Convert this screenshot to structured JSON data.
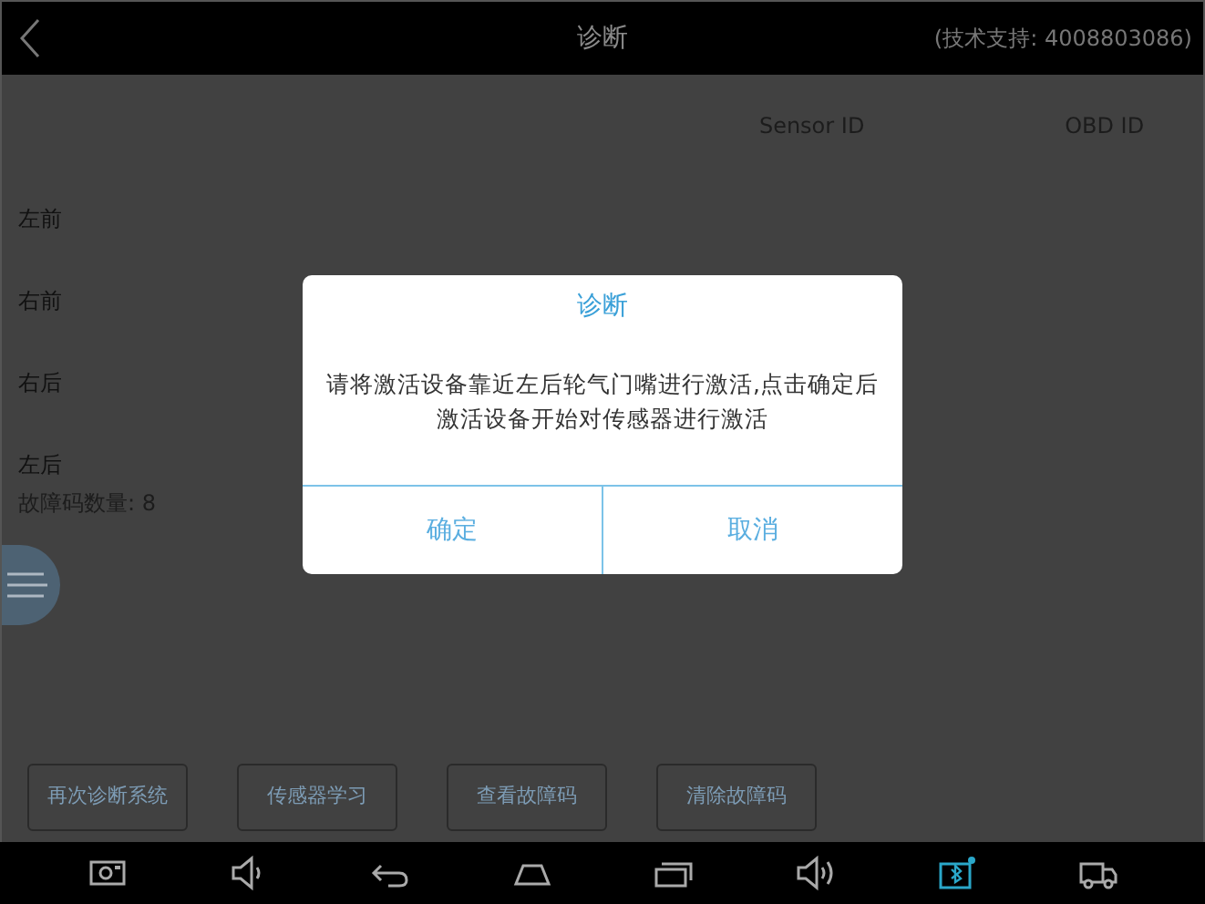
{
  "header": {
    "title": "诊断",
    "support": "(技术支持: 4008803086)"
  },
  "table": {
    "columns": [
      "Sensor ID",
      "OBD ID"
    ],
    "rows": [
      {
        "label": "左前"
      },
      {
        "label": "右前"
      },
      {
        "label": "右后"
      },
      {
        "label": "左后"
      }
    ]
  },
  "fault_count": "故障码数量: 8",
  "actions": [
    "再次诊断系统",
    "传感器学习",
    "查看故障码",
    "清除故障码"
  ],
  "dialog": {
    "title": "诊断",
    "message": "请将激活设备靠近左后轮气门嘴进行激活,点击确定后激活设备开始对传感器进行激活",
    "buttons": [
      "确定",
      "取消"
    ]
  }
}
